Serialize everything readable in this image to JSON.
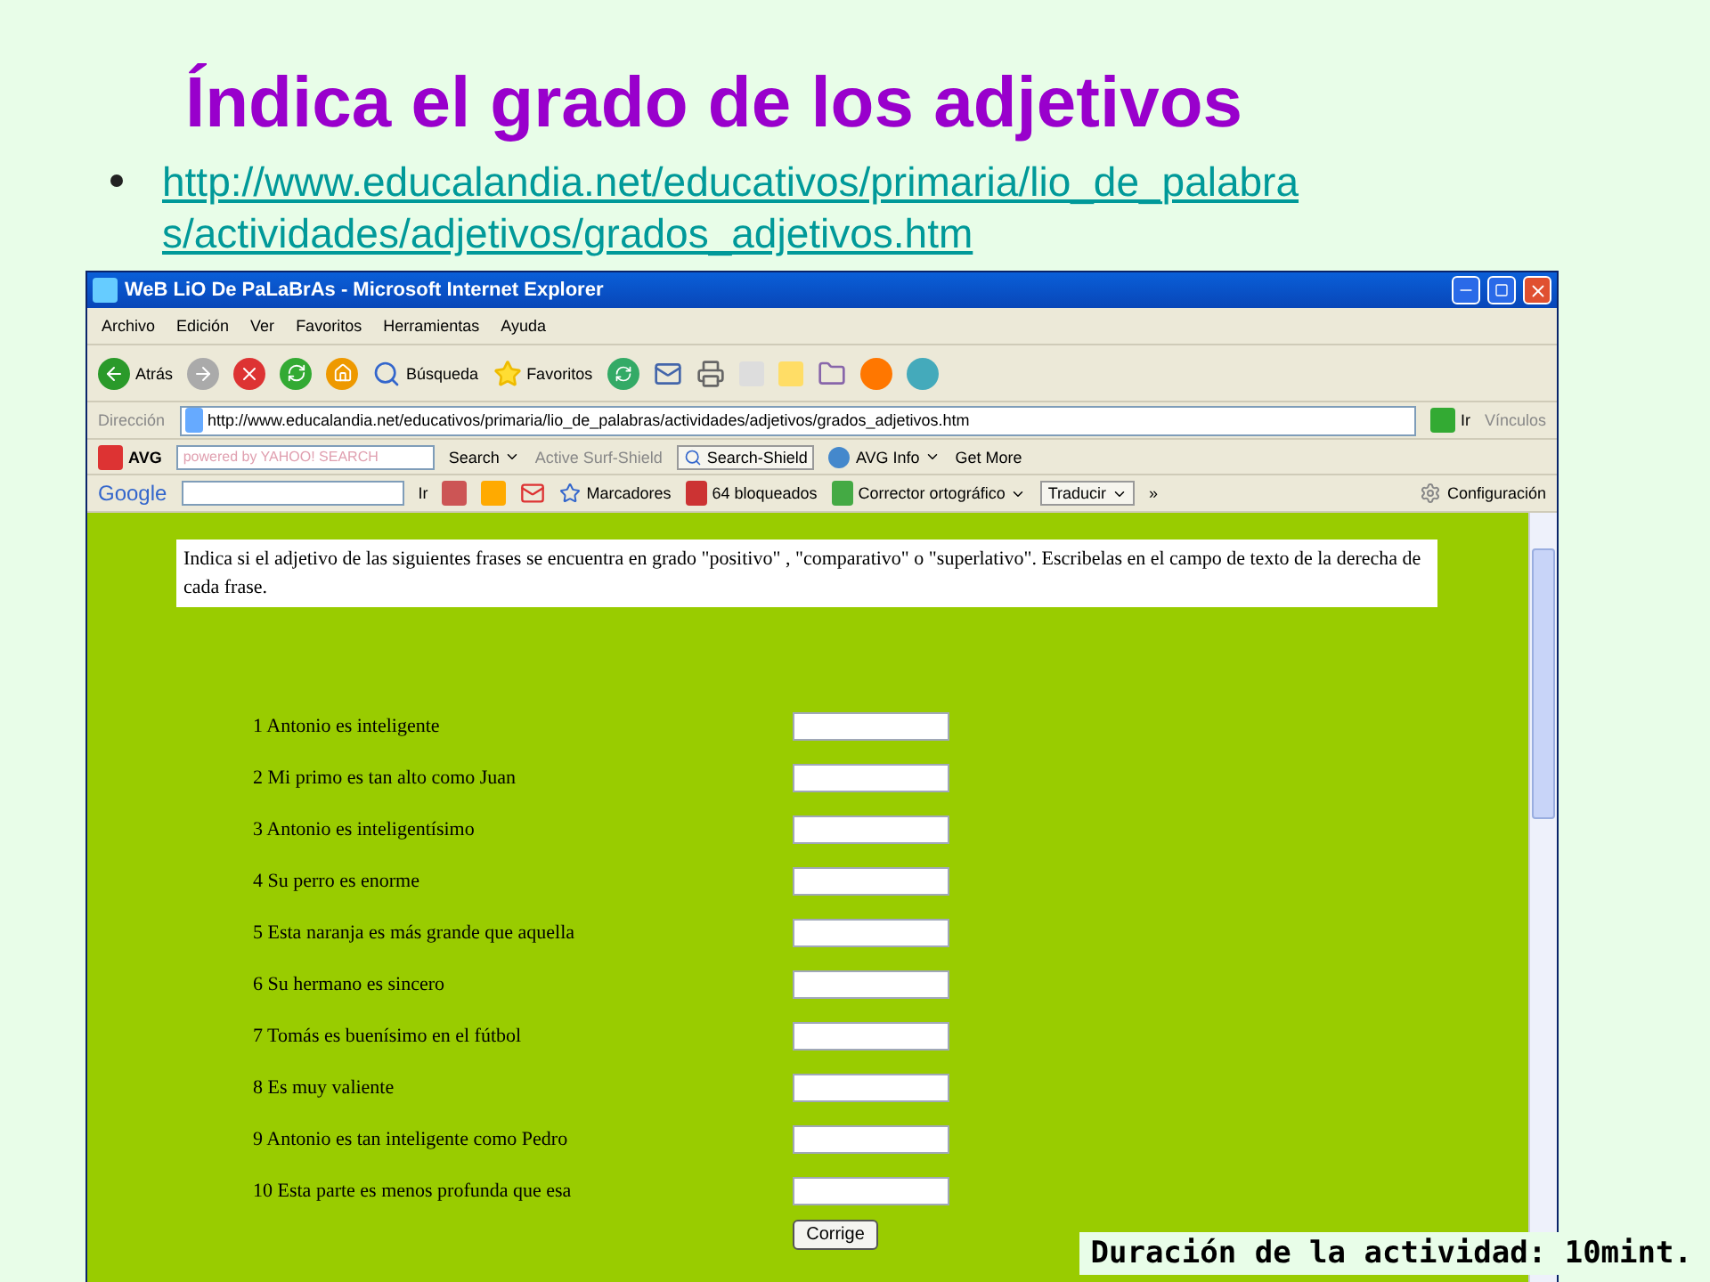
{
  "slide_title": "Índica el grado de los adjetivos",
  "link_lines": [
    "http://www.educalandia.net/educativos/primaria/lio_de_palabra",
    "s/actividades/adjetivos/grados_adjetivos.htm"
  ],
  "browser": {
    "title": "WeB LiO De PaLaBrAs - Microsoft Internet Explorer",
    "menu": [
      "Archivo",
      "Edición",
      "Ver",
      "Favoritos",
      "Herramientas",
      "Ayuda"
    ],
    "toolbar": {
      "back": "Atrás",
      "search": "Búsqueda",
      "favorites": "Favoritos"
    },
    "address": {
      "label": "Dirección",
      "url": "http://www.educalandia.net/educativos/primaria/lio_de_palabras/actividades/adjetivos/grados_adjetivos.htm",
      "go": "Ir",
      "links": "Vínculos"
    },
    "avg_bar": {
      "brand": "AVG",
      "search_placeholder": "powered by YAHOO! SEARCH",
      "search": "Search",
      "surf_shield": "Active Surf-Shield",
      "search_shield": "Search-Shield",
      "info": "AVG Info",
      "more": "Get More"
    },
    "google_bar": {
      "brand": "Google",
      "go": "Ir",
      "bookmarks": "Marcadores",
      "blocked": "64 bloqueados",
      "spell": "Corrector ortográfico",
      "translate": "Traducir",
      "more": "»",
      "settings": "Configuración"
    },
    "page": {
      "instructions": "Indica si el adjetivo de las siguientes frases se encuentra en grado \"positivo\" , \"comparativo\" o \"superlativo\". Escribelas en el campo de texto de la derecha de cada frase.",
      "questions": [
        "1 Antonio es inteligente",
        "2 Mi primo es tan alto como Juan",
        "3 Antonio es inteligentísimo",
        "4 Su perro es enorme",
        "5 Esta naranja es más grande que aquella",
        "6 Su hermano es sincero",
        "7 Tomás es buenísimo en el fútbol",
        "8 Es muy valiente",
        "9 Antonio es tan inteligente como Pedro",
        "10 Esta parte es menos profunda que esa"
      ],
      "button": "Corrige"
    }
  },
  "footer": "Duración de la actividad: 10mint."
}
